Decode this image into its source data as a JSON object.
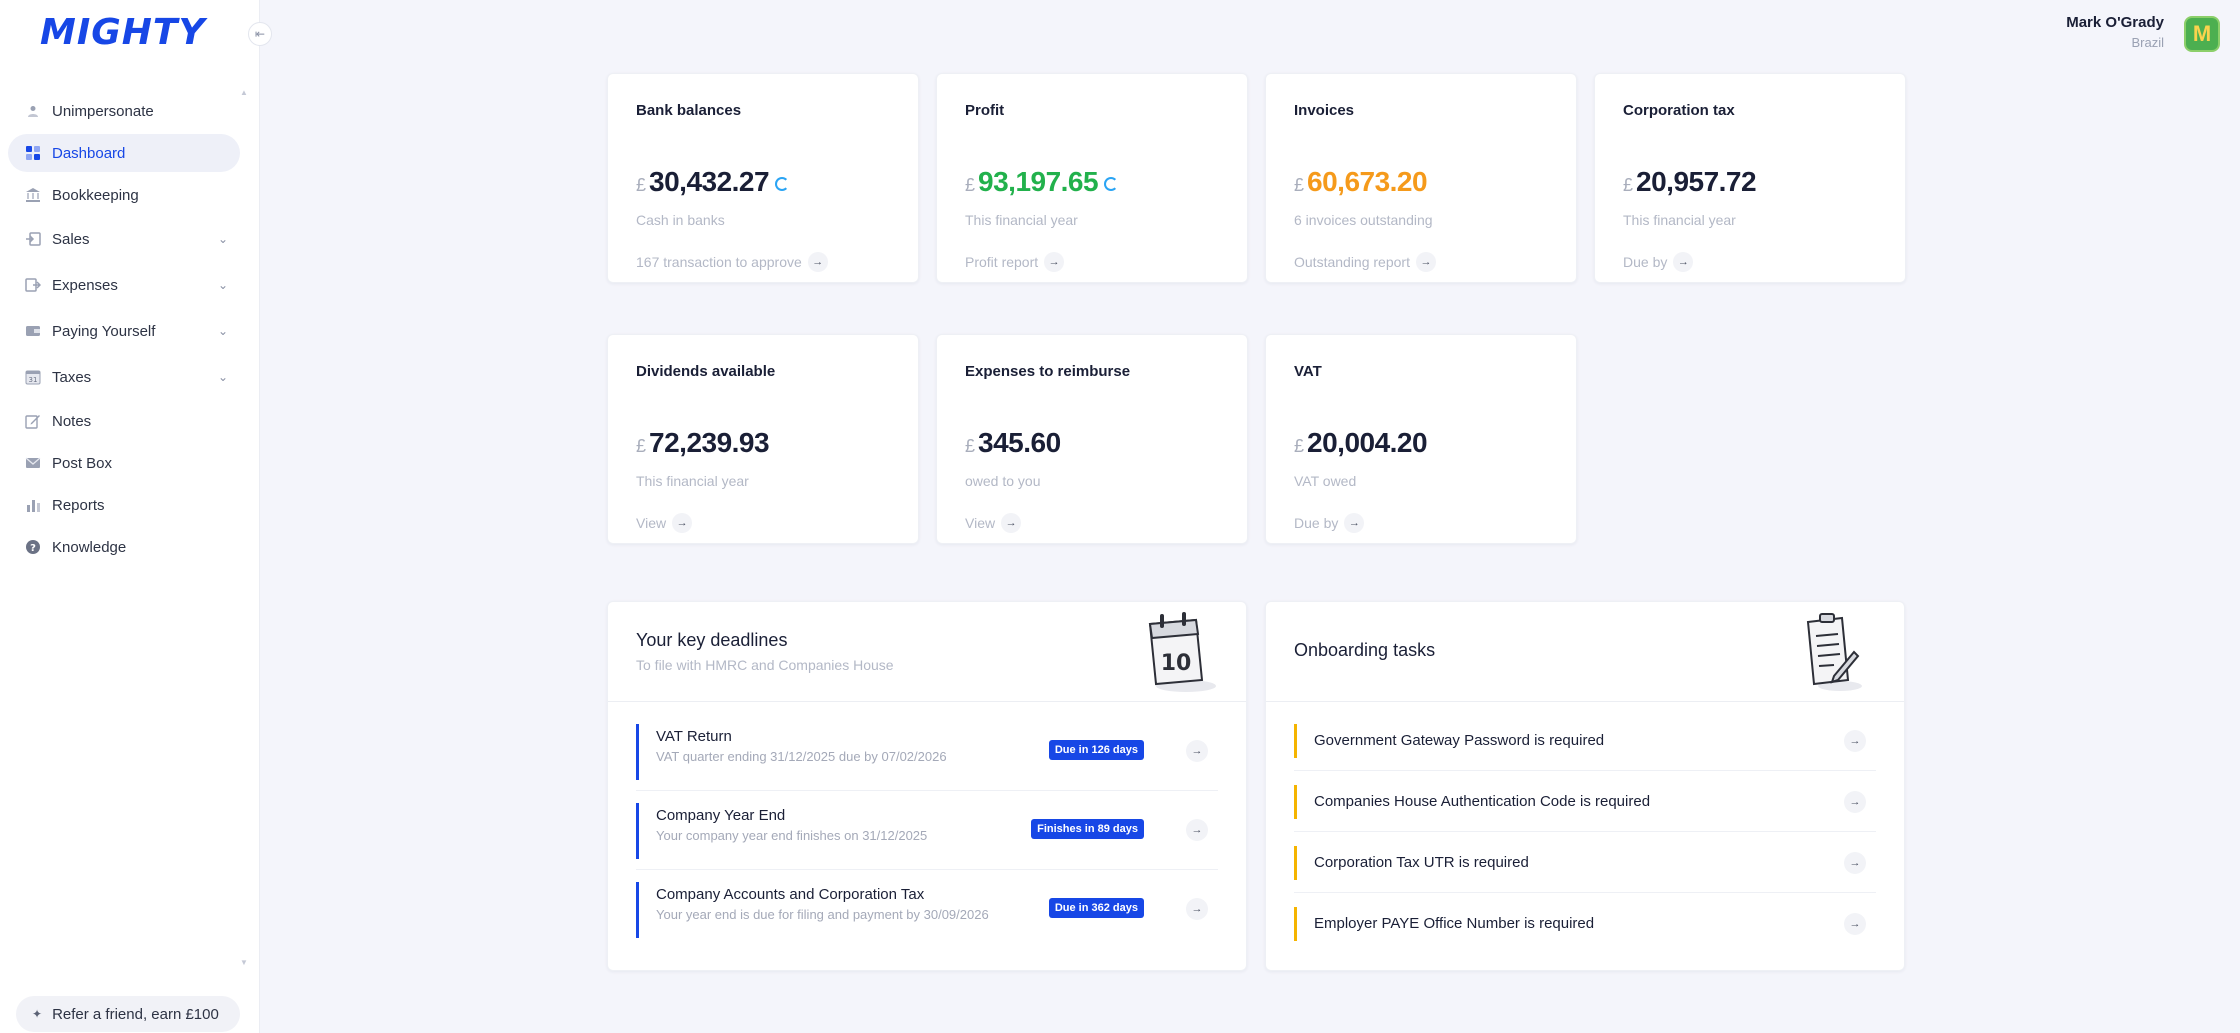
{
  "app": {
    "logo": "MIGHTY"
  },
  "user": {
    "name": "Mark O'Grady",
    "country": "Brazil",
    "avatar_letter": "M"
  },
  "sidebar": {
    "items": [
      {
        "label": "Unimpersonate",
        "icon": "user-icon",
        "active": false,
        "chevron": false
      },
      {
        "label": "Dashboard",
        "icon": "dashboard-icon",
        "active": true,
        "chevron": false
      },
      {
        "label": "Bookkeeping",
        "icon": "bank-icon",
        "active": false,
        "chevron": false
      },
      {
        "label": "Sales",
        "icon": "sales-icon",
        "active": false,
        "chevron": true
      },
      {
        "label": "Expenses",
        "icon": "expenses-icon",
        "active": false,
        "chevron": true
      },
      {
        "label": "Paying Yourself",
        "icon": "wallet-icon",
        "active": false,
        "chevron": true
      },
      {
        "label": "Taxes",
        "icon": "calendar-icon",
        "active": false,
        "chevron": true
      },
      {
        "label": "Notes",
        "icon": "note-icon",
        "active": false,
        "chevron": false
      },
      {
        "label": "Post Box",
        "icon": "mail-icon",
        "active": false,
        "chevron": false
      },
      {
        "label": "Reports",
        "icon": "chart-icon",
        "active": false,
        "chevron": false
      },
      {
        "label": "Knowledge",
        "icon": "help-icon",
        "active": false,
        "chevron": false
      }
    ],
    "refer": "Refer a friend, earn £100"
  },
  "stats": [
    {
      "title": "Bank balances",
      "currency": "£",
      "amount": "30,432.27",
      "color": "#1a1f36",
      "sub": "Cash in banks",
      "link": "167 transaction to approve",
      "loading": true
    },
    {
      "title": "Profit",
      "currency": "£",
      "amount": "93,197.65",
      "color": "#22b14c",
      "sub": "This financial year",
      "link": "Profit report",
      "loading": true
    },
    {
      "title": "Invoices",
      "currency": "£",
      "amount": "60,673.20",
      "color": "#f59a1b",
      "sub": "6 invoices outstanding",
      "link": "Outstanding report",
      "loading": false
    },
    {
      "title": "Corporation tax",
      "currency": "£",
      "amount": "20,957.72",
      "color": "#1a1f36",
      "sub": "This financial year",
      "link": "Due by",
      "loading": false
    },
    {
      "title": "Dividends available",
      "currency": "£",
      "amount": "72,239.93",
      "color": "#1a1f36",
      "sub": "This financial year",
      "link": "View",
      "loading": false
    },
    {
      "title": "Expenses to reimburse",
      "currency": "£",
      "amount": "345.60",
      "color": "#1a1f36",
      "sub": "owed to you",
      "link": "View",
      "loading": false
    },
    {
      "title": "VAT",
      "currency": "£",
      "amount": "20,004.20",
      "color": "#1a1f36",
      "sub": "VAT owed",
      "link": "Due by",
      "loading": false
    }
  ],
  "deadlines": {
    "title": "Your key deadlines",
    "subtitle": "To file with HMRC and Companies House",
    "items": [
      {
        "title": "VAT Return",
        "desc": "VAT quarter ending 31/12/2025 due by 07/02/2026",
        "badge": "Due in 126 days"
      },
      {
        "title": "Company Year End",
        "desc": "Your company year end finishes on 31/12/2025",
        "badge": "Finishes in 89 days"
      },
      {
        "title": "Company Accounts and Corporation Tax",
        "desc": "Your year end is due for filing and payment by 30/09/2026",
        "badge": "Due in 362 days"
      }
    ]
  },
  "onboarding": {
    "title": "Onboarding tasks",
    "items": [
      {
        "label": "Government Gateway Password is required"
      },
      {
        "label": "Companies House Authentication Code is required"
      },
      {
        "label": "Corporation Tax UTR is required"
      },
      {
        "label": "Employer PAYE Office Number is required"
      }
    ]
  },
  "illustrations": {
    "calendar_day": "10"
  }
}
